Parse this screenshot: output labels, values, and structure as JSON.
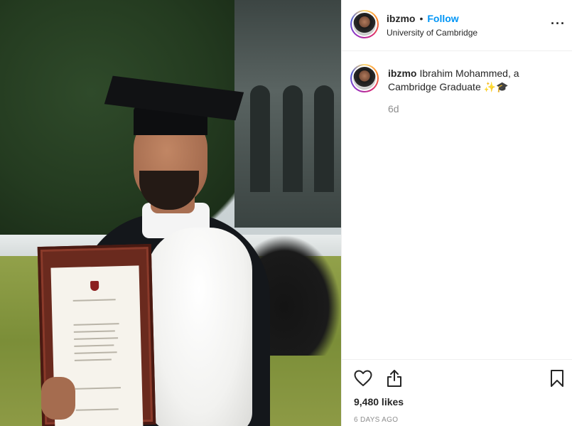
{
  "post": {
    "username": "ibzmo",
    "follow_label": "Follow",
    "separator": "•",
    "location": "University of Cambridge",
    "more_icon": "more-options-icon"
  },
  "caption": {
    "username": "ibzmo",
    "text": "Ibrahim Mohammed, a Cambridge Graduate ✨🎓",
    "time_ago": "6d"
  },
  "actions": {
    "like_icon": "heart-icon",
    "share_icon": "share-icon",
    "save_icon": "bookmark-icon"
  },
  "stats": {
    "likes": "9,480 likes",
    "date": "6 DAYS AGO"
  },
  "colors": {
    "follow_blue": "#0095f6",
    "muted_gray": "#8e8e8e",
    "text_dark": "#262626"
  }
}
